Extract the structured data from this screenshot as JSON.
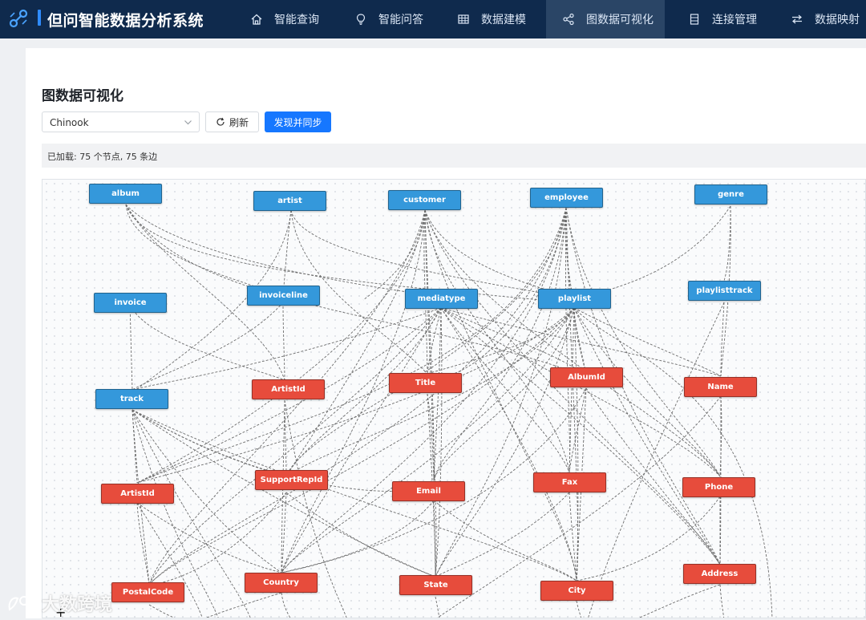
{
  "app": {
    "title": "但问智能数据分析系统"
  },
  "nav": [
    {
      "label": "智能查询",
      "icon": "home-icon"
    },
    {
      "label": "智能问答",
      "icon": "bulb-icon"
    },
    {
      "label": "数据建模",
      "icon": "table-icon"
    },
    {
      "label": "图数据可视化",
      "icon": "share-icon",
      "active": true
    },
    {
      "label": "连接管理",
      "icon": "server-icon"
    },
    {
      "label": "数据映射",
      "icon": "swap-icon"
    }
  ],
  "page": {
    "title": "图数据可视化",
    "database_select": {
      "value": "Chinook"
    },
    "refresh_label": "刷新",
    "sync_label": "发现并同步",
    "status": "已加载: 75 个节点, 75 条边"
  },
  "graph": {
    "colors": {
      "table": "#3498db",
      "column": "#e74c3c",
      "edge": "#555555"
    },
    "table_nodes": [
      "album",
      "artist",
      "customer",
      "employee",
      "genre",
      "invoice",
      "invoiceline",
      "mediatype",
      "playlist",
      "playlisttrack",
      "track"
    ],
    "column_nodes": [
      "ArtistId",
      "Title",
      "AlbumId",
      "Name",
      "ArtistId",
      "SupportRepId",
      "Email",
      "Fax",
      "Phone",
      "PostalCode",
      "Country",
      "State",
      "City",
      "Address"
    ]
  },
  "watermark": {
    "text": "大数跨境"
  }
}
